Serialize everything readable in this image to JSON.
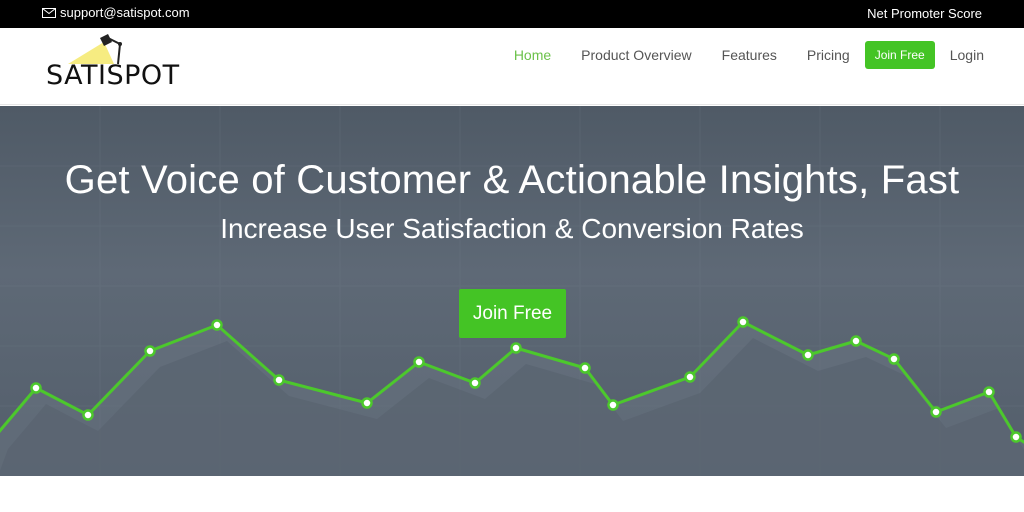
{
  "topbar": {
    "email": "support@satispot.com",
    "email_icon": "envelope-icon",
    "nps_link": "Net Promoter Score"
  },
  "brand": {
    "name": "SATISPOT",
    "logo_icon": "desk-lamp-icon"
  },
  "nav": {
    "items": [
      "Home",
      "Product Overview",
      "Features",
      "Pricing"
    ],
    "active": "Home",
    "join_label": "Join Free",
    "login_label": "Login"
  },
  "hero": {
    "headline": "Get Voice of Customer & Actionable Insights, Fast",
    "subheadline": "Increase User Satisfaction & Conversion Rates",
    "cta_label": "Join Free"
  },
  "colors": {
    "accent_green": "#44c425",
    "active_nav": "#6cc24a",
    "topbar_bg": "#000000",
    "hero_bg": "#56616d"
  }
}
